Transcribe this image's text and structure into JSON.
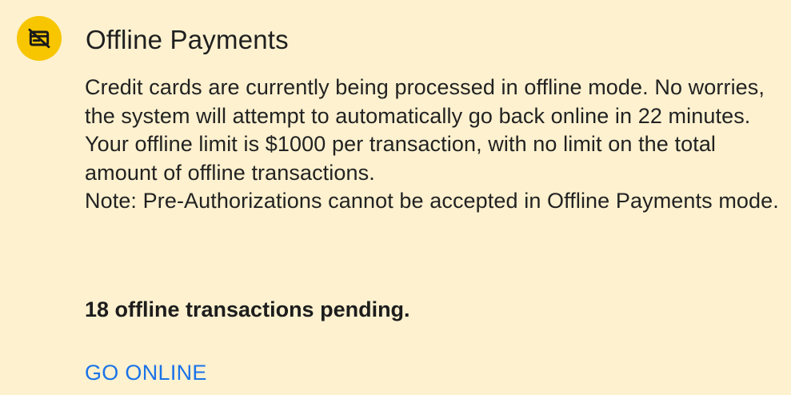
{
  "banner": {
    "icon": "offline-card-icon",
    "title": "Offline Payments",
    "message": "Credit cards are currently being processed in offline mode. No worries, the system will attempt to automatically go back online in 22 minutes. Your offline limit is $1000 per transaction, with no limit on the total amount of offline transactions.",
    "note": "Note: Pre-Authorizations cannot be accepted in Offline Payments mode.",
    "pending": "18 offline transactions pending.",
    "action_label": "GO ONLINE"
  },
  "colors": {
    "background": "#fdf1cf",
    "icon_badge": "#f7c600",
    "action": "#1a73e8",
    "text": "#1d1d1d"
  }
}
